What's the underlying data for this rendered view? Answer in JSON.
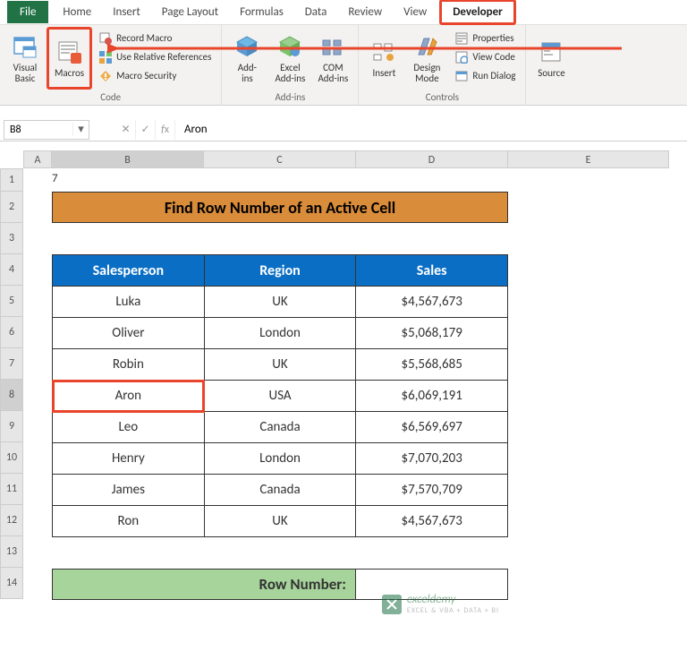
{
  "tabs": {
    "file": "File",
    "home": "Home",
    "insert": "Insert",
    "page_layout": "Page Layout",
    "formulas": "Formulas",
    "data": "Data",
    "review": "Review",
    "view": "View",
    "developer": "Developer"
  },
  "ribbon": {
    "code": {
      "label": "Code",
      "visual_basic": "Visual\nBasic",
      "macros": "Macros",
      "record_macro": "Record Macro",
      "use_relative": "Use Relative References",
      "macro_security": "Macro Security"
    },
    "addins": {
      "label": "Add-ins",
      "addins": "Add-\nins",
      "excel_addins": "Excel\nAdd-ins",
      "com_addins": "COM\nAdd-ins"
    },
    "controls": {
      "label": "Controls",
      "insert": "Insert",
      "design_mode": "Design\nMode",
      "properties": "Properties",
      "view_code": "View Code",
      "run_dialog": "Run Dialog"
    },
    "source": "Source"
  },
  "formula_bar": {
    "name_box": "B8",
    "value": "Aron"
  },
  "columns": [
    "A",
    "B",
    "C",
    "D",
    "E"
  ],
  "rows": [
    "1",
    "2",
    "3",
    "4",
    "5",
    "6",
    "7",
    "8",
    "9",
    "10",
    "11",
    "12",
    "13",
    "14"
  ],
  "sheet": {
    "a1": "7",
    "title": "Find Row Number of an Active Cell",
    "headers": {
      "b": "Salesperson",
      "c": "Region",
      "d": "Sales"
    },
    "data": [
      {
        "sp": "Luka",
        "rg": "UK",
        "sl": "$4,567,673"
      },
      {
        "sp": "Oliver",
        "rg": "London",
        "sl": "$5,068,179"
      },
      {
        "sp": "Robin",
        "rg": "UK",
        "sl": "$5,568,685"
      },
      {
        "sp": "Aron",
        "rg": "USA",
        "sl": "$6,069,191"
      },
      {
        "sp": "Leo",
        "rg": "Canada",
        "sl": "$6,569,697"
      },
      {
        "sp": "Henry",
        "rg": "London",
        "sl": "$7,070,203"
      },
      {
        "sp": "James",
        "rg": "Canada",
        "sl": "$7,570,709"
      },
      {
        "sp": "Ron",
        "rg": "UK",
        "sl": "$4,567,673"
      }
    ],
    "row_number_label": "Row Number:",
    "row_number_value": ""
  },
  "watermark": {
    "brand": "exceldemy",
    "sub": "EXCEL & VBA + DATA + BI"
  }
}
